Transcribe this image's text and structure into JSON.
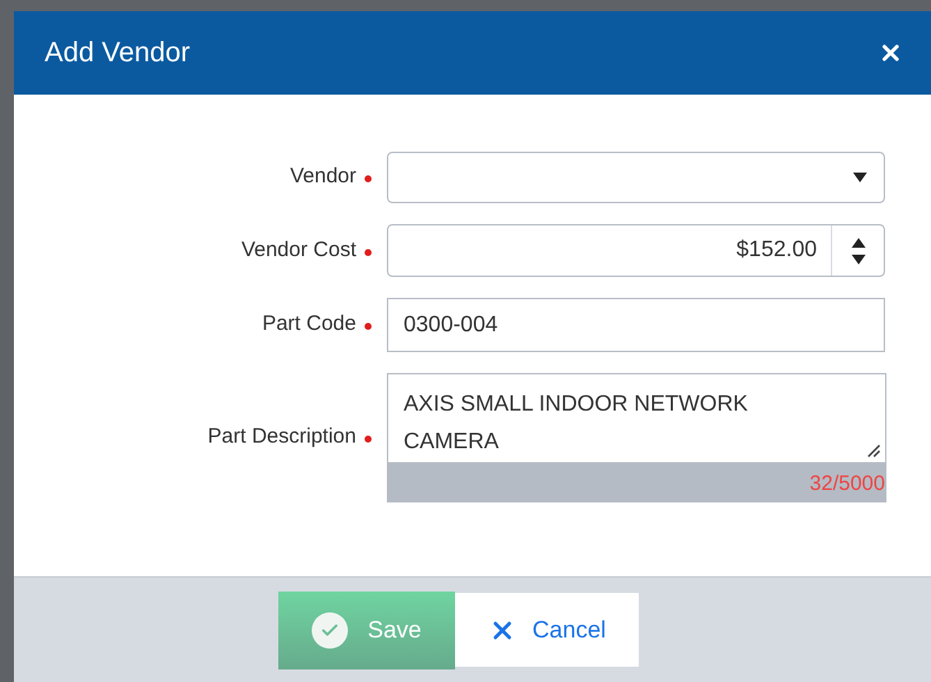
{
  "dialog": {
    "title": "Add Vendor"
  },
  "fields": [
    {
      "label": "Vendor",
      "kind": "select",
      "required": true
    },
    {
      "label": "Vendor Cost",
      "kind": "number",
      "required": true,
      "value": "$152.00"
    },
    {
      "label": "Part Code",
      "kind": "text",
      "required": true,
      "value": "0300-004"
    },
    {
      "label": "Part Description",
      "kind": "textarea",
      "required": true,
      "value": "AXIS SMALL INDOOR NETWORK CAMERA",
      "counter": "32/5000"
    }
  ],
  "buttons": [
    {
      "label": "Save",
      "kind": "save"
    },
    {
      "label": "Cancel",
      "kind": "cancel"
    }
  ]
}
